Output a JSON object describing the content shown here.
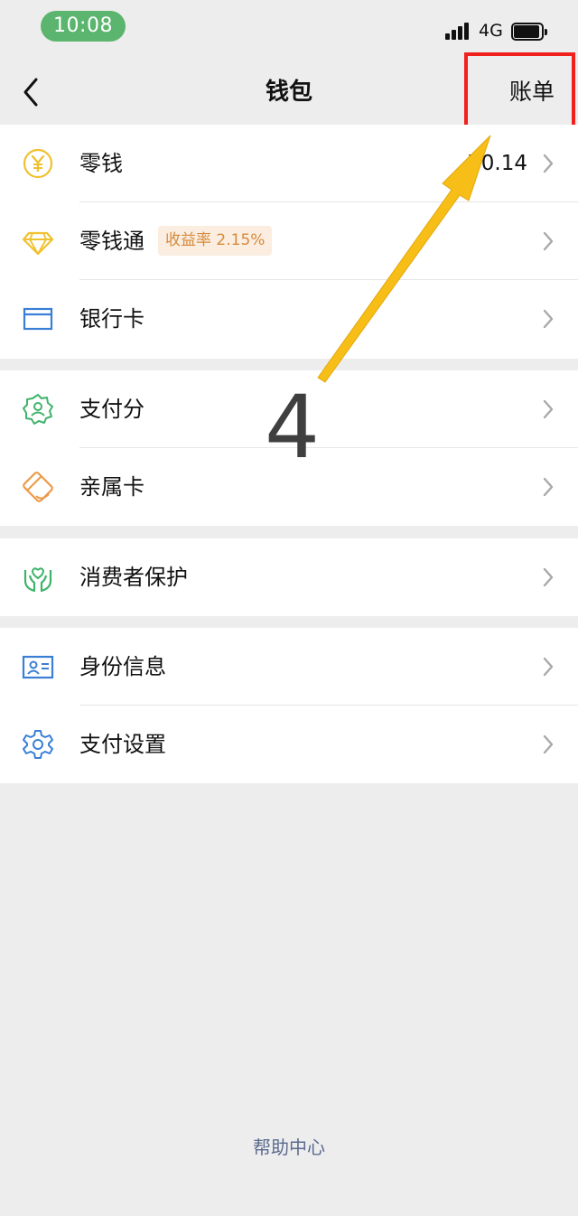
{
  "status_bar": {
    "time": "10:08",
    "network": "4G"
  },
  "nav": {
    "title": "钱包",
    "bill_label": "账单"
  },
  "groups": [
    {
      "rows": [
        {
          "label": "零钱",
          "value": "¥0.14",
          "icon": "yuan-coin-icon"
        },
        {
          "label": "零钱通",
          "badge": "收益率 2.15%",
          "icon": "diamond-icon"
        },
        {
          "label": "银行卡",
          "icon": "bank-card-icon"
        }
      ]
    },
    {
      "rows": [
        {
          "label": "支付分",
          "icon": "pay-score-badge-icon"
        },
        {
          "label": "亲属卡",
          "icon": "family-card-icon"
        }
      ]
    },
    {
      "rows": [
        {
          "label": "消费者保护",
          "icon": "protect-hands-icon"
        }
      ]
    },
    {
      "rows": [
        {
          "label": "身份信息",
          "icon": "id-card-icon"
        },
        {
          "label": "支付设置",
          "icon": "gear-icon"
        }
      ]
    }
  ],
  "footer": {
    "help_label": "帮助中心"
  },
  "annotation": {
    "step_number": "4"
  },
  "colors": {
    "page_bg": "#ededed",
    "highlight": "#f0201c",
    "arrow": "#f6be17",
    "badge_bg": "#fbeee0",
    "badge_text": "#d68a3c",
    "help_link": "#5b6b8f",
    "time_pill": "#5bb56e"
  }
}
